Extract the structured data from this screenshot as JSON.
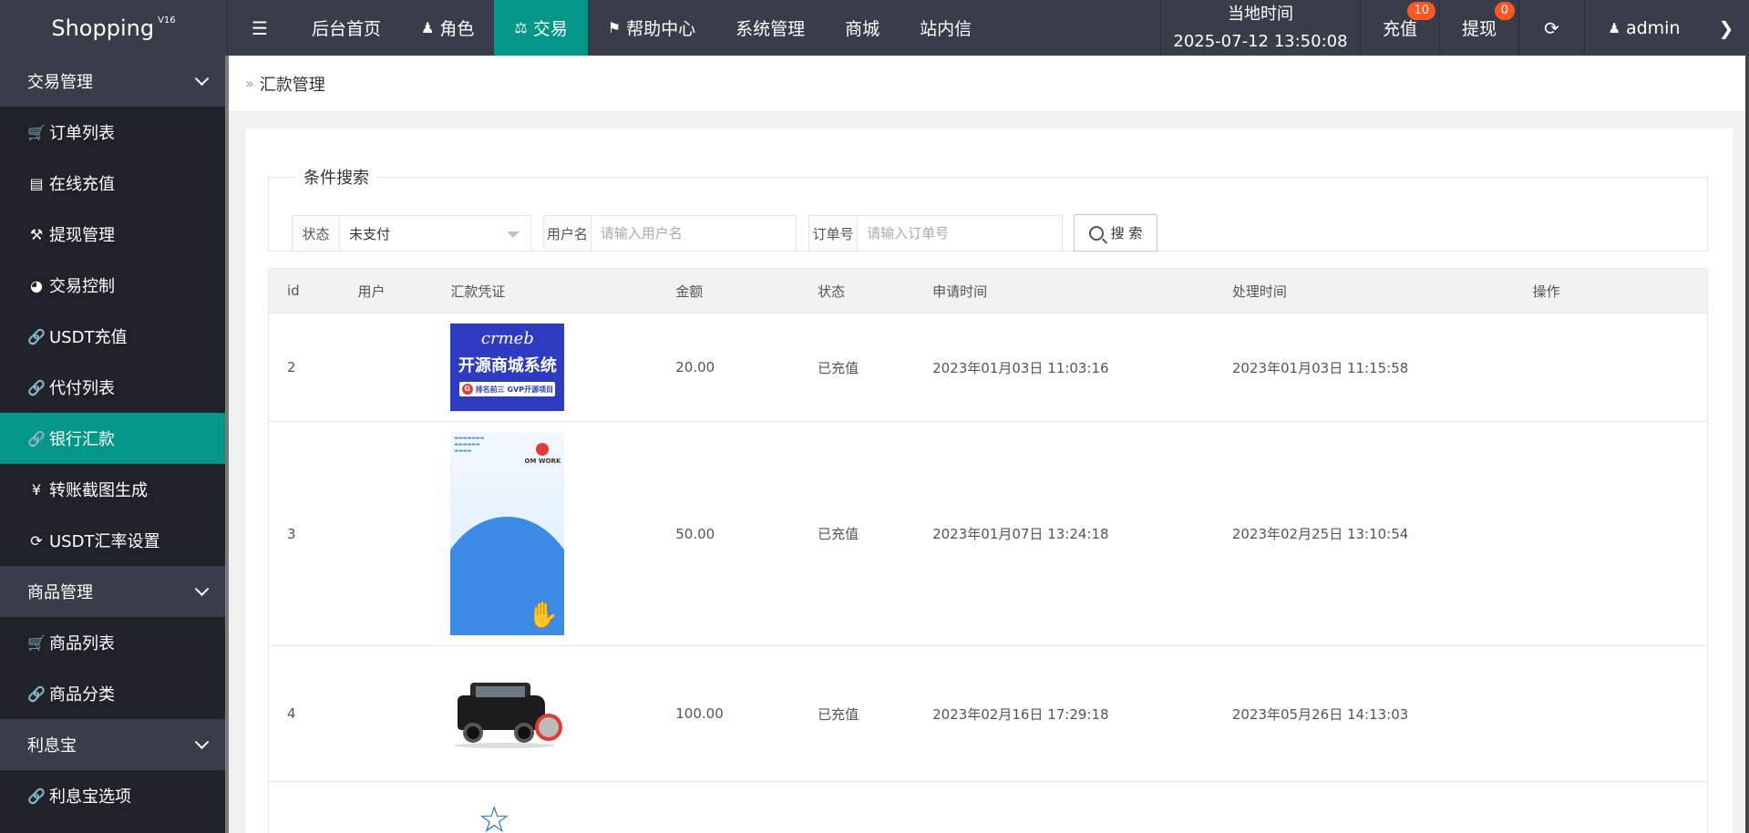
{
  "header": {
    "logo": "Shopping",
    "logo_version": "V16",
    "nav": [
      {
        "label": "后台首页",
        "icon": "",
        "active": false
      },
      {
        "label": "角色",
        "icon": "user-icon",
        "active": false
      },
      {
        "label": "交易",
        "icon": "scale-icon",
        "active": true
      },
      {
        "label": "帮助中心",
        "icon": "flag-icon",
        "active": false
      },
      {
        "label": "系统管理",
        "icon": "",
        "active": false
      },
      {
        "label": "商城",
        "icon": "",
        "active": false
      },
      {
        "label": "站内信",
        "icon": "",
        "active": false
      }
    ],
    "clock_label": "当地时间",
    "clock_value": "2025-07-12 13:50:08",
    "recharge_label": "充值",
    "recharge_badge": "10",
    "withdraw_label": "提现",
    "withdraw_badge": "0",
    "user": "admin"
  },
  "sidebar": {
    "groups": [
      {
        "label": "交易管理",
        "items": [
          {
            "label": "订单列表",
            "icon": "cart-icon"
          },
          {
            "label": "在线充值",
            "icon": "book-icon"
          },
          {
            "label": "提现管理",
            "icon": "gavel-icon"
          },
          {
            "label": "交易控制",
            "icon": "gauge-icon"
          },
          {
            "label": "USDT充值",
            "icon": "link-icon"
          },
          {
            "label": "代付列表",
            "icon": "link-icon"
          },
          {
            "label": "银行汇款",
            "icon": "link-icon",
            "active": true
          },
          {
            "label": "转账截图生成",
            "icon": "yen-icon"
          },
          {
            "label": "USDT汇率设置",
            "icon": "refresh-icon"
          }
        ]
      },
      {
        "label": "商品管理",
        "items": [
          {
            "label": "商品列表",
            "icon": "cart-icon"
          },
          {
            "label": "商品分类",
            "icon": "link-icon"
          }
        ]
      },
      {
        "label": "利息宝",
        "items": [
          {
            "label": "利息宝选项",
            "icon": "link-icon"
          }
        ]
      }
    ]
  },
  "breadcrumb": "汇款管理",
  "search": {
    "legend": "条件搜索",
    "status_label": "状态",
    "status_value": "未支付",
    "username_label": "用户名",
    "username_placeholder": "请输入用户名",
    "order_label": "订单号",
    "order_placeholder": "请输入订单号",
    "button": "搜 索"
  },
  "table": {
    "headers": [
      "id",
      "用户",
      "汇款凭证",
      "金额",
      "状态",
      "申请时间",
      "处理时间",
      "操作"
    ],
    "rows": [
      {
        "id": "2",
        "user": "",
        "voucher": "crmeb-banner",
        "voucher_brand": "crmeb",
        "voucher_title": "开源商城系统",
        "voucher_sub": "排名前三 GVP开源项目",
        "amount": "20.00",
        "status": "已充值",
        "apply_time": "2023年01月03日 11:03:16",
        "process_time": "2023年01月03日 11:15:58"
      },
      {
        "id": "3",
        "user": "",
        "voucher": "omwork-poster",
        "voucher_logo": "OM WORK",
        "amount": "50.00",
        "status": "已充值",
        "apply_time": "2023年01月07日 13:24:18",
        "process_time": "2023年02月25日 13:10:54"
      },
      {
        "id": "4",
        "user": "",
        "voucher": "black-suv-photo",
        "amount": "100.00",
        "status": "已充值",
        "apply_time": "2023年02月16日 17:29:18",
        "process_time": "2023年05月26日 14:13:03"
      },
      {
        "id": "",
        "user": "",
        "voucher": "star-logo",
        "amount": "",
        "status": "",
        "apply_time": "",
        "process_time": ""
      }
    ]
  },
  "colors": {
    "topbar": "#393d49",
    "sidebar": "#20222a",
    "accent": "#009688",
    "badge": "#ff5722"
  }
}
